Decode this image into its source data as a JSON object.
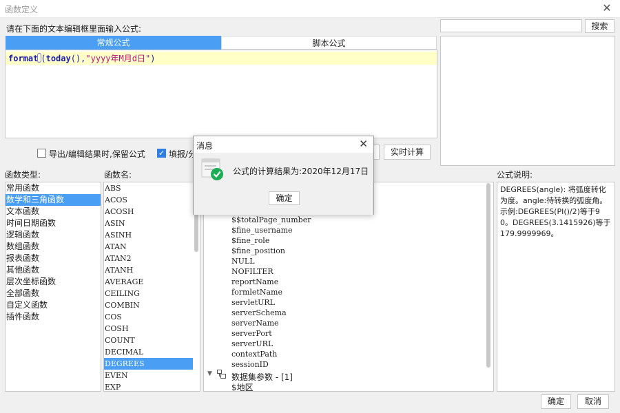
{
  "window": {
    "title": "函数定义",
    "close_glyph": "✕"
  },
  "prompt_label": "请在下面的文本编辑框里面输入公式:",
  "search": {
    "value": "",
    "button_label": "搜索"
  },
  "tabs": [
    {
      "label": "常规公式"
    },
    {
      "label": "脚本公式"
    }
  ],
  "editor": {
    "code_parts": [
      "format",
      "(",
      "today",
      "(),",
      "\"yyyy年M月d日\"",
      ")"
    ]
  },
  "options": {
    "keep_formula_label": "导出/编辑结果时,保留公式",
    "keep_formula_checked": false,
    "fill_label": "填报/分",
    "fill_checked": true
  },
  "realtime_calc_label": "实时计算",
  "categories": {
    "header": "函数类型:",
    "selected": 1,
    "items": [
      "常用函数",
      "数学和三角函数",
      "文本函数",
      "时间日期函数",
      "逻辑函数",
      "数组函数",
      "报表函数",
      "其他函数",
      "层次坐标函数",
      "全部函数",
      "自定义函数",
      "插件函数"
    ]
  },
  "functions": {
    "header": "函数名:",
    "selected": 15,
    "items": [
      "ABS",
      "ACOS",
      "ACOSH",
      "ASIN",
      "ASINH",
      "ATAN",
      "ATAN2",
      "ATANH",
      "AVERAGE",
      "CEILING",
      "COMBIN",
      "COS",
      "COSH",
      "COUNT",
      "DECIMAL",
      "DEGREES",
      "EVEN",
      "EXP"
    ]
  },
  "variables": {
    "items": [
      "$$totalPage_number",
      "$fine_username",
      "$fine_role",
      "$fine_position",
      "NULL",
      "NOFILTER",
      "reportName",
      "formletName",
      "servletURL",
      "serverSchema",
      "serverName",
      "serverPort",
      "serverURL",
      "contextPath",
      "sessionID"
    ],
    "group_label": "数据集参数 - [1]",
    "group_child": "$地区"
  },
  "description": {
    "header": "公式说明:",
    "text": "DEGREES(angle): 将弧度转化为度。angle:待转换的弧度角。示例:DEGREES(PI()/2)等于90。DEGREES(3.1415926)等于179.9999969。"
  },
  "dialog": {
    "title": "消息",
    "message": "公式的计算结果为:2020年12月17日",
    "ok_label": "确定"
  },
  "footer": {
    "ok_label": "确定",
    "cancel_label": "取消"
  },
  "colors": {
    "accent": "#4a9ff4",
    "success": "#1aad55"
  }
}
